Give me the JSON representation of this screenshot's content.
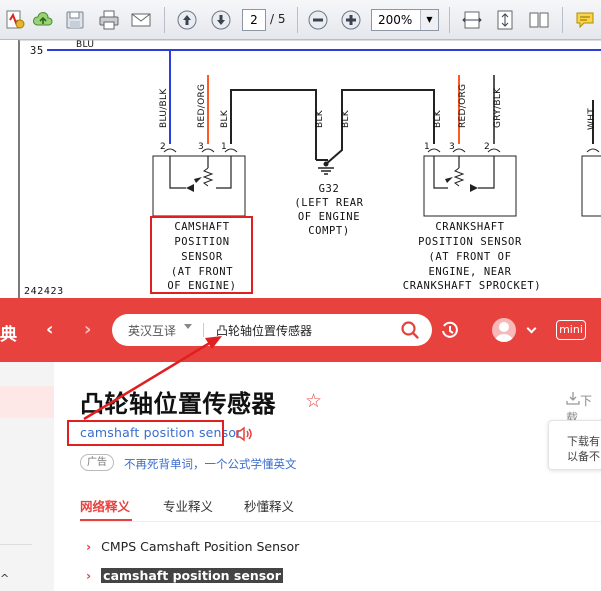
{
  "toolbar": {
    "page_current": "2",
    "page_total": "/ 5",
    "zoom": "200%"
  },
  "schematic": {
    "top_wire_number": "35",
    "top_wire_label": "BLU",
    "wire_labels": [
      "BLU/BLK",
      "RED/ORG",
      "BLK",
      "BLK",
      "BLK",
      "BLK",
      "RED/ORG",
      "GRY/BLK",
      "WHT"
    ],
    "pin_labels": [
      "2",
      "3",
      "1",
      "1",
      "3",
      "2"
    ],
    "cam_sensor": [
      "CAMSHAFT",
      "POSITION",
      "SENSOR",
      "(AT FRONT",
      "OF ENGINE)"
    ],
    "ground_label": [
      "G32",
      "(LEFT REAR",
      "OF ENGINE",
      "COMPT)"
    ],
    "crank_sensor": [
      "CRANKSHAFT",
      "POSITION SENSOR",
      "(AT FRONT OF",
      "ENGINE, NEAR",
      "CRANKSHAFT SPROCKET)"
    ],
    "figure_number": "242423"
  },
  "dict": {
    "brand": "典",
    "mode": "英汉互译",
    "query": "凸轮轴位置传感器",
    "mini_label": "mini",
    "headword": "凸轮轴位置传感器",
    "translation": "camshaft position sensor",
    "ad_badge": "广告",
    "ad_text": "不再死背单词，一个公式学懂英文",
    "tabs": [
      "网络释义",
      "专业释义",
      "秒懂释义"
    ],
    "results": [
      "CMPS Camshaft Position Sensor",
      "camshaft position sensor"
    ],
    "download_label": "下载",
    "tip_lines": [
      "下载有",
      "以备不"
    ]
  },
  "colors": {
    "brand_red": "#e8423f",
    "link_blue": "#3a6ccf",
    "annotation_red": "#e02020"
  }
}
